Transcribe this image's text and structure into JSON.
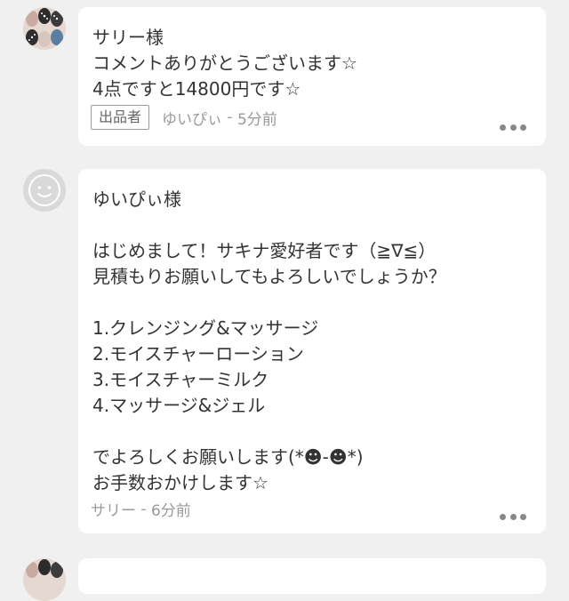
{
  "comments": [
    {
      "text": "サリー様\nコメントありがとうございます☆\n4点ですと14800円です☆",
      "badge": "出品者",
      "author": "ゆいぴぃ",
      "separator": " - ",
      "time": "5分前"
    },
    {
      "text": "ゆいぴぃ様\n\nはじめまして！サキナ愛好者です（≧∇≦）\n見積もりお願いしてもよろしいでしょうか？\n\n1.クレンジング&マッサージ\n2.モイスチャーローション\n3.モイスチャーミルク\n4.マッサージ&ジェル\n\nでよろしくお願いします(*☻-☻*)\nお手数おかけします☆",
      "author": "サリー",
      "separator": " - ",
      "time": "6分前"
    }
  ],
  "colors": {
    "background": "#f0f0f0",
    "bubble": "#ffffff",
    "text": "#333333",
    "meta_text": "#999999",
    "more_dots": "#888888"
  },
  "icons": {
    "avatar_seller": "patterned-avatar",
    "avatar_buyer": "default-smiley-avatar",
    "more": "more-dots-icon"
  }
}
